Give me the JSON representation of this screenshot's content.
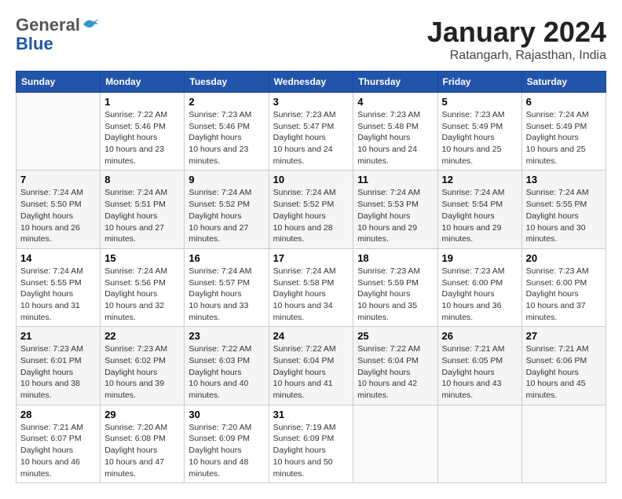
{
  "header": {
    "logo_general": "General",
    "logo_blue": "Blue",
    "month_title": "January 2024",
    "location": "Ratangarh, Rajasthan, India"
  },
  "weekdays": [
    "Sunday",
    "Monday",
    "Tuesday",
    "Wednesday",
    "Thursday",
    "Friday",
    "Saturday"
  ],
  "weeks": [
    [
      {
        "day": "",
        "sunrise": "",
        "sunset": "",
        "daylight": ""
      },
      {
        "day": "1",
        "sunrise": "7:22 AM",
        "sunset": "5:46 PM",
        "daylight": "10 hours and 23 minutes."
      },
      {
        "day": "2",
        "sunrise": "7:23 AM",
        "sunset": "5:46 PM",
        "daylight": "10 hours and 23 minutes."
      },
      {
        "day": "3",
        "sunrise": "7:23 AM",
        "sunset": "5:47 PM",
        "daylight": "10 hours and 24 minutes."
      },
      {
        "day": "4",
        "sunrise": "7:23 AM",
        "sunset": "5:48 PM",
        "daylight": "10 hours and 24 minutes."
      },
      {
        "day": "5",
        "sunrise": "7:23 AM",
        "sunset": "5:49 PM",
        "daylight": "10 hours and 25 minutes."
      },
      {
        "day": "6",
        "sunrise": "7:24 AM",
        "sunset": "5:49 PM",
        "daylight": "10 hours and 25 minutes."
      }
    ],
    [
      {
        "day": "7",
        "sunrise": "7:24 AM",
        "sunset": "5:50 PM",
        "daylight": "10 hours and 26 minutes."
      },
      {
        "day": "8",
        "sunrise": "7:24 AM",
        "sunset": "5:51 PM",
        "daylight": "10 hours and 27 minutes."
      },
      {
        "day": "9",
        "sunrise": "7:24 AM",
        "sunset": "5:52 PM",
        "daylight": "10 hours and 27 minutes."
      },
      {
        "day": "10",
        "sunrise": "7:24 AM",
        "sunset": "5:52 PM",
        "daylight": "10 hours and 28 minutes."
      },
      {
        "day": "11",
        "sunrise": "7:24 AM",
        "sunset": "5:53 PM",
        "daylight": "10 hours and 29 minutes."
      },
      {
        "day": "12",
        "sunrise": "7:24 AM",
        "sunset": "5:54 PM",
        "daylight": "10 hours and 29 minutes."
      },
      {
        "day": "13",
        "sunrise": "7:24 AM",
        "sunset": "5:55 PM",
        "daylight": "10 hours and 30 minutes."
      }
    ],
    [
      {
        "day": "14",
        "sunrise": "7:24 AM",
        "sunset": "5:55 PM",
        "daylight": "10 hours and 31 minutes."
      },
      {
        "day": "15",
        "sunrise": "7:24 AM",
        "sunset": "5:56 PM",
        "daylight": "10 hours and 32 minutes."
      },
      {
        "day": "16",
        "sunrise": "7:24 AM",
        "sunset": "5:57 PM",
        "daylight": "10 hours and 33 minutes."
      },
      {
        "day": "17",
        "sunrise": "7:24 AM",
        "sunset": "5:58 PM",
        "daylight": "10 hours and 34 minutes."
      },
      {
        "day": "18",
        "sunrise": "7:23 AM",
        "sunset": "5:59 PM",
        "daylight": "10 hours and 35 minutes."
      },
      {
        "day": "19",
        "sunrise": "7:23 AM",
        "sunset": "6:00 PM",
        "daylight": "10 hours and 36 minutes."
      },
      {
        "day": "20",
        "sunrise": "7:23 AM",
        "sunset": "6:00 PM",
        "daylight": "10 hours and 37 minutes."
      }
    ],
    [
      {
        "day": "21",
        "sunrise": "7:23 AM",
        "sunset": "6:01 PM",
        "daylight": "10 hours and 38 minutes."
      },
      {
        "day": "22",
        "sunrise": "7:23 AM",
        "sunset": "6:02 PM",
        "daylight": "10 hours and 39 minutes."
      },
      {
        "day": "23",
        "sunrise": "7:22 AM",
        "sunset": "6:03 PM",
        "daylight": "10 hours and 40 minutes."
      },
      {
        "day": "24",
        "sunrise": "7:22 AM",
        "sunset": "6:04 PM",
        "daylight": "10 hours and 41 minutes."
      },
      {
        "day": "25",
        "sunrise": "7:22 AM",
        "sunset": "6:04 PM",
        "daylight": "10 hours and 42 minutes."
      },
      {
        "day": "26",
        "sunrise": "7:21 AM",
        "sunset": "6:05 PM",
        "daylight": "10 hours and 43 minutes."
      },
      {
        "day": "27",
        "sunrise": "7:21 AM",
        "sunset": "6:06 PM",
        "daylight": "10 hours and 45 minutes."
      }
    ],
    [
      {
        "day": "28",
        "sunrise": "7:21 AM",
        "sunset": "6:07 PM",
        "daylight": "10 hours and 46 minutes."
      },
      {
        "day": "29",
        "sunrise": "7:20 AM",
        "sunset": "6:08 PM",
        "daylight": "10 hours and 47 minutes."
      },
      {
        "day": "30",
        "sunrise": "7:20 AM",
        "sunset": "6:09 PM",
        "daylight": "10 hours and 48 minutes."
      },
      {
        "day": "31",
        "sunrise": "7:19 AM",
        "sunset": "6:09 PM",
        "daylight": "10 hours and 50 minutes."
      },
      {
        "day": "",
        "sunrise": "",
        "sunset": "",
        "daylight": ""
      },
      {
        "day": "",
        "sunrise": "",
        "sunset": "",
        "daylight": ""
      },
      {
        "day": "",
        "sunrise": "",
        "sunset": "",
        "daylight": ""
      }
    ]
  ]
}
